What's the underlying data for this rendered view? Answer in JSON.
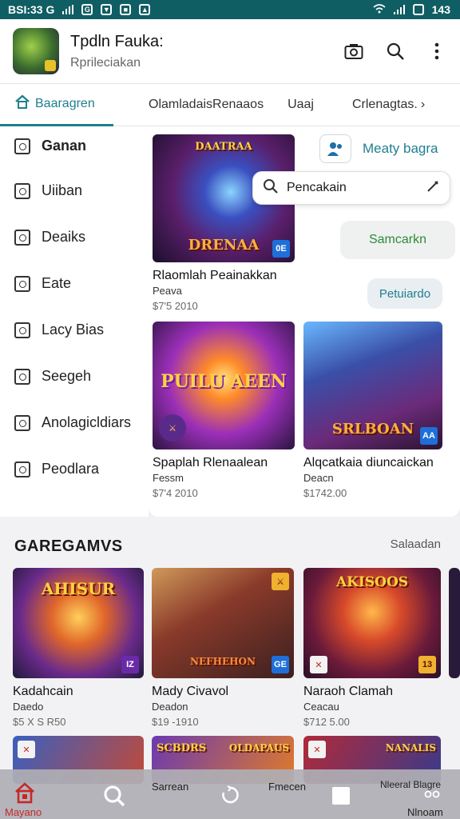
{
  "status_bar": {
    "time": "BSI:33 G",
    "battery": "143"
  },
  "header": {
    "title": "Tpdln Fauka:",
    "subtitle": "Rprileciakan"
  },
  "tabs": [
    "Baaragren",
    "OlamladaisRenaaos",
    "Uaaj",
    "Crlenagtas."
  ],
  "sidebar": {
    "items": [
      {
        "label": "Ganan",
        "icon": "tools-icon"
      },
      {
        "label": "Uiiban",
        "icon": "checkbox-icon"
      },
      {
        "label": "Deaiks",
        "icon": "edit-icon"
      },
      {
        "label": "Eate",
        "icon": "camera-icon"
      },
      {
        "label": "Lacy Bias",
        "icon": "image-icon"
      },
      {
        "label": "Seegeh",
        "icon": "chat-icon"
      },
      {
        "label": "Anolagicldiars",
        "icon": "grid-icon"
      },
      {
        "label": "Peodlara",
        "icon": "circle-icon"
      }
    ]
  },
  "featured": {
    "main": {
      "art_text_top": "DAATRAA",
      "art_text_bottom": "DRENAA",
      "badge": "0E",
      "title": "Rlaomlah Peainakkan",
      "subtitle": "Peava",
      "price": "$7'5 2010"
    },
    "cards": [
      {
        "art_text": "PUILU AEEN",
        "title": "Spaplah Rlenaalean",
        "subtitle": "Fessm",
        "price": "$7'4 2010"
      },
      {
        "art_text": "SRLBOAN",
        "badge": "AA",
        "title": "Alqcatkaia diuncaickan",
        "subtitle": "Deacn",
        "price": "$1742.00"
      }
    ],
    "user_pill": "Meaty bagra",
    "search_placeholder": "Pencakain",
    "pill_green": "Samcarkn",
    "pill_blue": "Petuiardo"
  },
  "section": {
    "title": "GAREGAMVS",
    "link": "Salaadan",
    "games": [
      {
        "art_text": "AHISUR",
        "badge": "IZ",
        "title": "Kadahcain",
        "subtitle": "Daedo",
        "price": "$5 X S R50"
      },
      {
        "art_text": "NEFHEHON",
        "badge": "GE",
        "title": "Mady Civavol",
        "subtitle": "Deadon",
        "price": "$19 -1910"
      },
      {
        "art_text": "AKISOOS",
        "badge": "13",
        "title": "Naraoh Clamah",
        "subtitle": "Ceacau",
        "price": "$712 5.00"
      }
    ],
    "bottom_art": [
      "",
      "SCBDRS",
      "OLDAPAUS",
      "NANALIS"
    ]
  },
  "bottom_nav": {
    "items": [
      {
        "label": "Mayano",
        "icon": "home-icon"
      },
      {
        "label": "",
        "icon": "search-icon"
      },
      {
        "label": "Sarrean",
        "icon": ""
      },
      {
        "label": "",
        "icon": "refresh-icon"
      },
      {
        "label": "Fmecen",
        "icon": ""
      },
      {
        "label": "",
        "icon": "square-icon"
      },
      {
        "label": "Nleeral Blagre",
        "icon": ""
      },
      {
        "label": "Nlnoam",
        "icon": "people-icon"
      }
    ]
  },
  "colors": {
    "accent": "#1f7f8f",
    "status_bar": "#0f5e63",
    "green_text": "#2e8b3a",
    "nav_active": "#c62828"
  }
}
